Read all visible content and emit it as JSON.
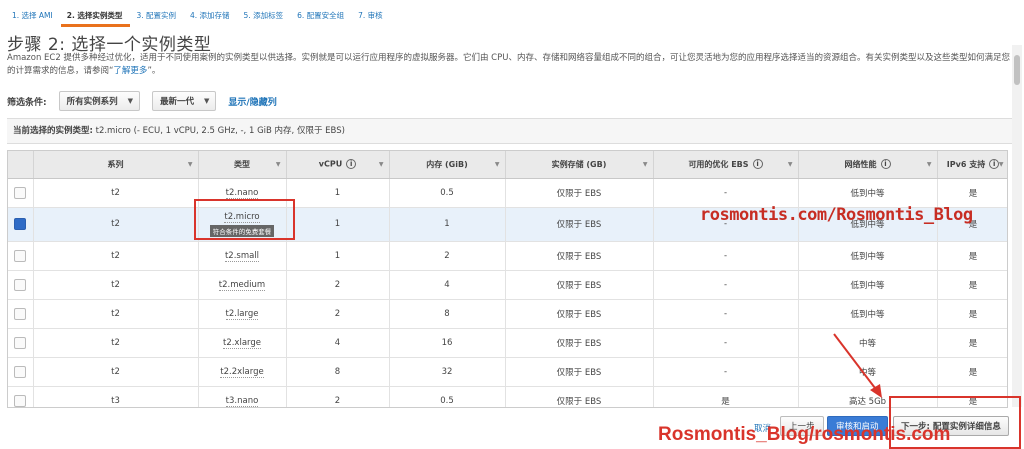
{
  "steps": [
    {
      "label": "1. 选择 AMI",
      "active": false
    },
    {
      "label": "2. 选择实例类型",
      "active": true
    },
    {
      "label": "3. 配置实例",
      "active": false
    },
    {
      "label": "4. 添加存储",
      "active": false
    },
    {
      "label": "5. 添加标签",
      "active": false
    },
    {
      "label": "6. 配置安全组",
      "active": false
    },
    {
      "label": "7. 审核",
      "active": false
    }
  ],
  "page": {
    "title": "步骤 2: 选择一个实例类型",
    "desc": "Amazon EC2 提供多种经过优化，适用于不同使用案例的实例类型以供选择。实例就是可以运行应用程序的虚拟服务器。它们由 CPU、内存、存储和网络容量组成不同的组合，可让您灵活地为您的应用程序选择适当的资源组合。有关实例类型以及这些类型如何满足您的计算需求的信息，请参阅",
    "learn_more": "了解更多",
    "desc_end": "。"
  },
  "filter": {
    "label": "筛选条件:",
    "family": "所有实例系列",
    "generation": "最新一代",
    "show_hide": "显示/隐藏列"
  },
  "current": {
    "label": "当前选择的实例类型:",
    "value": "t2.micro (- ECU, 1 vCPU, 2.5 GHz, -, 1 GiB 内存, 仅限于 EBS)"
  },
  "table": {
    "headers": [
      "系列",
      "类型",
      "vCPU",
      "内存 (GiB)",
      "实例存储 (GB)",
      "可用的优化 EBS",
      "网络性能",
      "IPv6 支持"
    ],
    "rows": [
      [
        "t2",
        "t2.nano",
        "1",
        "0.5",
        "仅限于 EBS",
        "-",
        "低到中等",
        "是"
      ],
      [
        "t2",
        "t2.micro",
        "1",
        "1",
        "仅限于 EBS",
        "-",
        "低到中等",
        "是"
      ],
      [
        "t2",
        "t2.small",
        "1",
        "2",
        "仅限于 EBS",
        "-",
        "低到中等",
        "是"
      ],
      [
        "t2",
        "t2.medium",
        "2",
        "4",
        "仅限于 EBS",
        "-",
        "低到中等",
        "是"
      ],
      [
        "t2",
        "t2.large",
        "2",
        "8",
        "仅限于 EBS",
        "-",
        "低到中等",
        "是"
      ],
      [
        "t2",
        "t2.xlarge",
        "4",
        "16",
        "仅限于 EBS",
        "-",
        "中等",
        "是"
      ],
      [
        "t2",
        "t2.2xlarge",
        "8",
        "32",
        "仅限于 EBS",
        "-",
        "中等",
        "是"
      ],
      [
        "t3",
        "t3.nano",
        "2",
        "0.5",
        "仅限于 EBS",
        "是",
        "高达 5Gb",
        "是"
      ]
    ],
    "selected_index": 1,
    "free_tier_tag": "符合条件的免费套餐"
  },
  "footer": {
    "cancel": "取消",
    "previous": "上一步",
    "launch": "审核和启动",
    "next": "下一步: 配置实例详细信息"
  },
  "watermarks": {
    "top": "rosmontis.com/Rosmontis_Blog",
    "bottom": "Rosmontis_Blog/rosmontis.com"
  },
  "colors": {
    "link": "#1f74b8",
    "active_step": "#e9711c",
    "annotation_red": "#d9342b",
    "primary_button": "#3a7cd6"
  }
}
